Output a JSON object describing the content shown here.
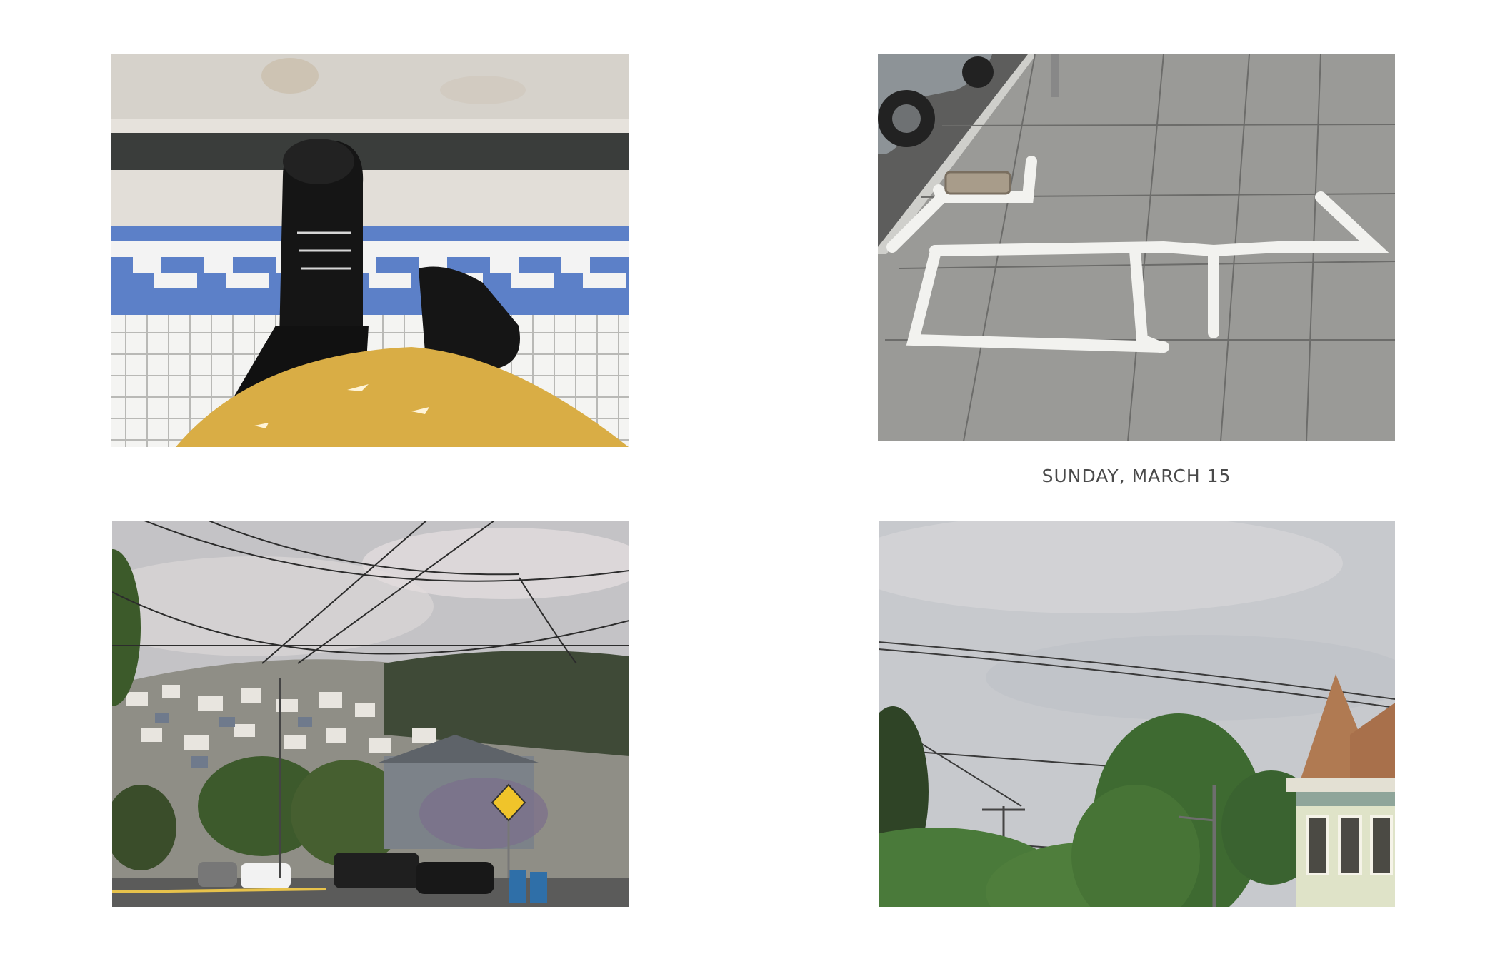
{
  "caption": {
    "date": "SUNDAY, MARCH 15"
  },
  "photos": [
    {
      "id": "boots",
      "subject": "Black boots standing on a blue and white tiled step, mustard coat hem"
    },
    {
      "id": "sidewalk",
      "subject": "Concrete sidewalk with white chalk outlines beside a parked car"
    },
    {
      "id": "hillside",
      "subject": "Hillside neighborhood with houses, power lines, street, parked cars and a yellow road sign"
    },
    {
      "id": "trees",
      "subject": "Overcast sky with power lines, green trees and a Victorian house turret"
    }
  ],
  "colors": {
    "tile_blue": "#5c80c8",
    "coat_mustard": "#d9ad45",
    "sky_gray": "#c7c9cd",
    "caption_text": "#4a4a4a"
  }
}
